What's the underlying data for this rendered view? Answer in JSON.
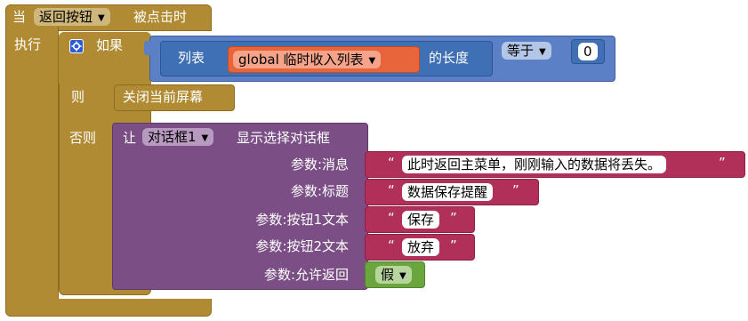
{
  "event": {
    "when_label": "当",
    "component_dropdown": "返回按钮",
    "event_name": "被点击时",
    "do_label": "执行"
  },
  "if_block": {
    "if_label": "如果",
    "then_label": "则",
    "else_label": "否则"
  },
  "condition": {
    "list_label": "列表",
    "variable": "global 临时收入列表",
    "length_label": "的长度",
    "operator": "等于",
    "number": "0"
  },
  "then_action": {
    "label": "关闭当前屏幕"
  },
  "else_action": {
    "call_label": "让",
    "component": "对话框1",
    "method": "显示选择对话框",
    "params": [
      {
        "label": "参数:消息",
        "value": "此时返回主菜单，刚刚输入的数据将丢失。"
      },
      {
        "label": "参数:标题",
        "value": "数据保存提醒"
      },
      {
        "label": "参数:按钮1文本",
        "value": "保存"
      },
      {
        "label": "参数:按钮2文本",
        "value": "放弃"
      },
      {
        "label": "参数:允许返回",
        "value": "假"
      }
    ],
    "quote": "“",
    "quote_close": "”"
  },
  "colors": {
    "event": "#b18b33",
    "control": "#5b80c5",
    "math_compare": "#5b80c5",
    "list": "#3f6fb5",
    "variable": "#e8643a",
    "component_method": "#7b4f86",
    "text": "#b0305a",
    "logic": "#6ba53d"
  }
}
